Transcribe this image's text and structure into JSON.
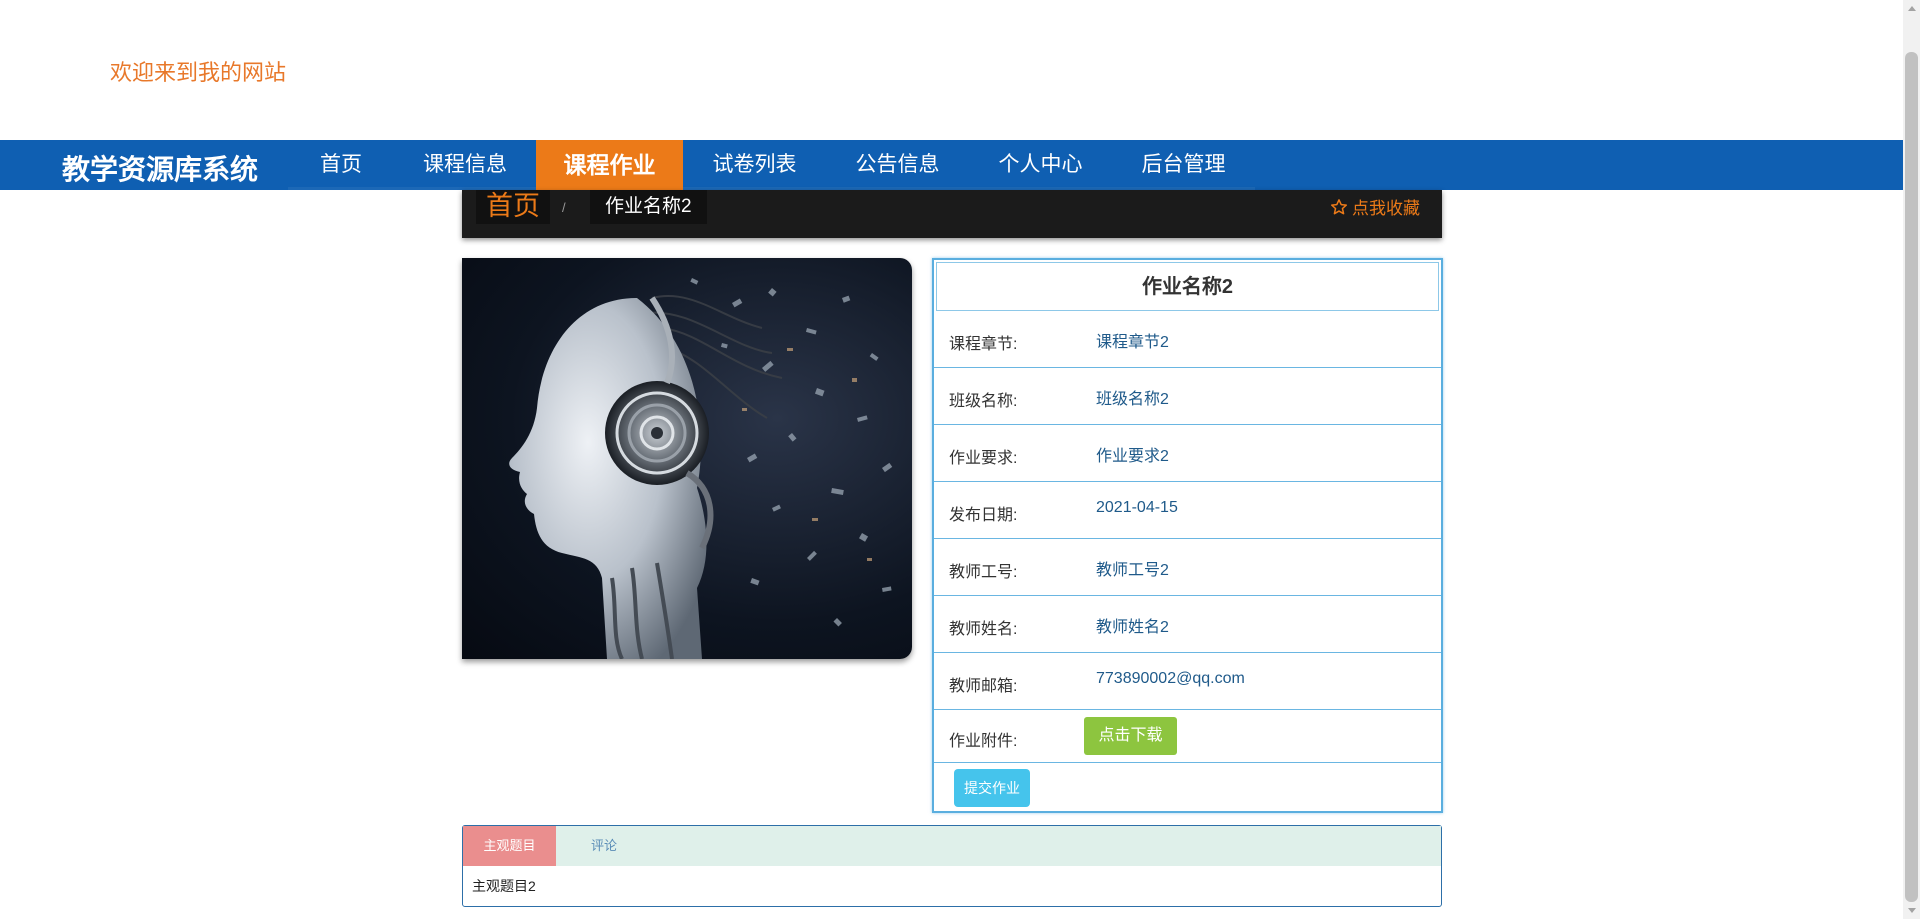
{
  "header": {
    "welcome": "欢迎来到我的网站"
  },
  "navbar": {
    "brand": "教学资源库系统",
    "items": [
      {
        "label": "首页"
      },
      {
        "label": "课程信息"
      },
      {
        "label": "课程作业",
        "active": true
      },
      {
        "label": "试卷列表"
      },
      {
        "label": "公告信息"
      },
      {
        "label": "个人中心"
      },
      {
        "label": "后台管理"
      }
    ]
  },
  "breadcrumb": {
    "home": "首页",
    "separator": "/",
    "current": "作业名称2",
    "favorite": "点我收藏"
  },
  "details": {
    "title": "作业名称2",
    "fields": [
      {
        "label": "课程章节:",
        "value": "课程章节2"
      },
      {
        "label": "班级名称:",
        "value": "班级名称2"
      },
      {
        "label": "作业要求:",
        "value": "作业要求2"
      },
      {
        "label": "发布日期:",
        "value": "2021-04-15"
      },
      {
        "label": "教师工号:",
        "value": "教师工号2"
      },
      {
        "label": "教师姓名:",
        "value": "教师姓名2"
      },
      {
        "label": "教师邮箱:",
        "value": "773890002@qq.com"
      }
    ],
    "attachment_label": "作业附件:",
    "download_label": "点击下载",
    "submit_label": "提交作业"
  },
  "tabs": {
    "items": [
      {
        "label": "主观题目",
        "active": true
      },
      {
        "label": "评论",
        "active": false
      }
    ],
    "content": "主观题目2"
  },
  "colors": {
    "nav_bg": "#0f5fb2",
    "accent": "#ec7a18",
    "download": "#8dc53f",
    "submit": "#45c4ec",
    "tab_active": "#ea8e8e"
  }
}
